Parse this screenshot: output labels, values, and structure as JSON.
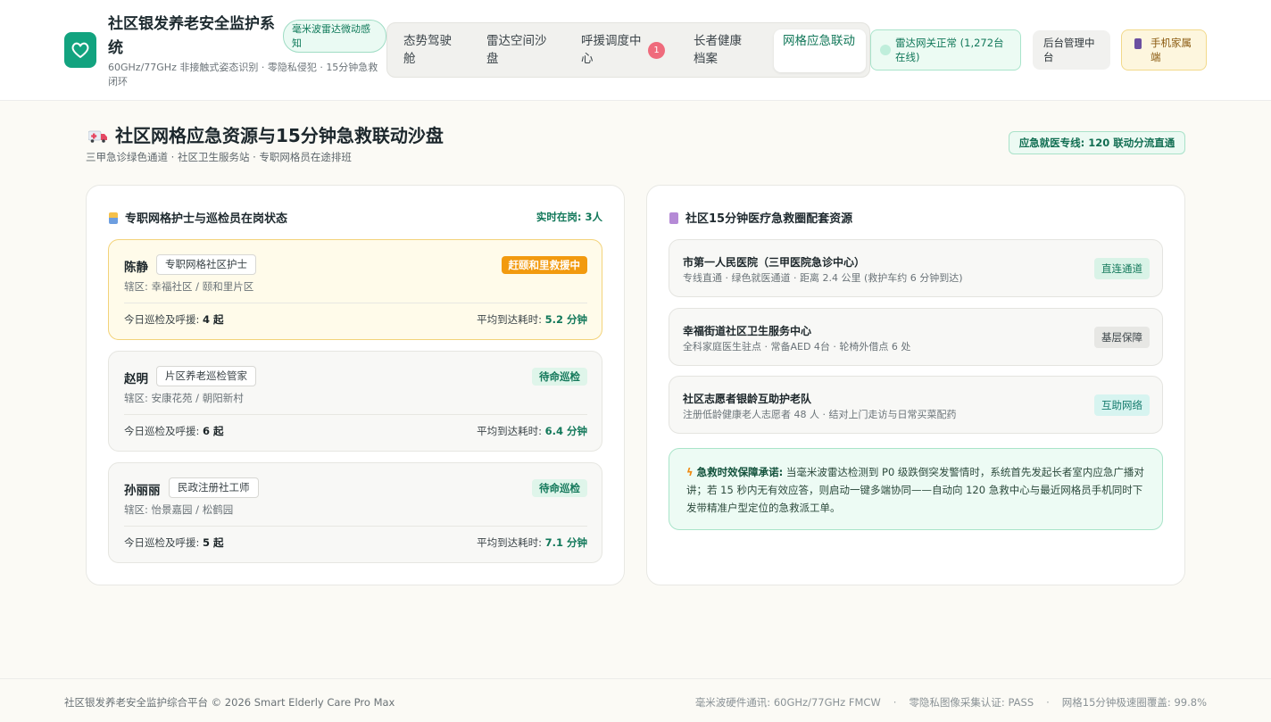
{
  "header": {
    "app_title": "社区银发养老安全监护系统",
    "app_subtitle": "60GHz/77GHz 非接触式姿态识别 · 零隐私侵犯 · 15分钟急救闭环",
    "badge": "毫米波雷达微动感知",
    "tabs": [
      {
        "label": "态势驾驶舱",
        "active": false
      },
      {
        "label": "雷达空间沙盘",
        "active": false
      },
      {
        "label": "呼援调度中心",
        "active": false,
        "count": "1"
      },
      {
        "label": "长者健康档案",
        "active": false
      },
      {
        "label": "网格应急联动",
        "active": true
      }
    ],
    "gateway_status": "雷达网关正常 (1,272台在线)",
    "admin_label": "后台管理中台",
    "family_label": "手机家属端"
  },
  "page": {
    "title": "社区网格应急资源与15分钟急救联动沙盘",
    "subtitle": "三甲急诊绿色通道 · 社区卫生服务站 · 专职网格员在途排班",
    "hotline": "应急就医专线: 120 联动分流直通"
  },
  "staff_panel": {
    "title": "专职网格护士与巡检员在岗状态",
    "on_duty": "实时在岗: 3人",
    "patrol_label": "今日巡检及呼援:",
    "eta_label": "平均到达耗时:",
    "staff": [
      {
        "name": "陈静",
        "role": "专职网格社区护士",
        "area": "辖区: 幸福社区 / 颐和里片区",
        "status": "赶颐和里救援中",
        "status_type": "rescue",
        "patrols": "4 起",
        "eta": "5.2 分钟"
      },
      {
        "name": "赵明",
        "role": "片区养老巡检管家",
        "area": "辖区: 安康花苑 / 朝阳新村",
        "status": "待命巡检",
        "status_type": "standby",
        "patrols": "6 起",
        "eta": "6.4 分钟"
      },
      {
        "name": "孙丽丽",
        "role": "民政注册社工师",
        "area": "辖区: 怡景嘉园 / 松鹤园",
        "status": "待命巡检",
        "status_type": "standby",
        "patrols": "5 起",
        "eta": "7.1 分钟"
      }
    ]
  },
  "resource_panel": {
    "title": "社区15分钟医疗急救圈配套资源",
    "resources": [
      {
        "name": "市第一人民医院（三甲医院急诊中心）",
        "desc": "专线直通 · 绿色就医通道 · 距离 2.4 公里 (救护车约 6 分钟到达)",
        "tag": "直连通道"
      },
      {
        "name": "幸福街道社区卫生服务中心",
        "desc": "全科家庭医生驻点 · 常备AED 4台 · 轮椅外借点 6 处",
        "tag": "基层保障"
      },
      {
        "name": "社区志愿者银龄互助护老队",
        "desc": "注册低龄健康老人志愿者 48 人 · 结对上门走访与日常买菜配药",
        "tag": "互助网络"
      }
    ],
    "guarantee_title": "急救时效保障承诺:",
    "guarantee_text": "当毫米波雷达检测到 P0 级跌倒突发警情时，系统首先发起长者室内应急广播对讲；若 15 秒内无有效应答，则启动一键多端协同——自动向 120 急救中心与最近网格员手机同时下发带精准户型定位的急救派工单。"
  },
  "footer": {
    "copyright": "社区银发养老安全监护综合平台 © 2026 Smart Elderly Care Pro Max",
    "specs": [
      "毫米波硬件通讯: 60GHz/77GHz FMCW",
      "零隐私图像采集认证: PASS",
      "网格15分钟极速圈覆盖: 99.8%"
    ],
    "separator": "·"
  },
  "colors": {
    "brand": "#12a37f",
    "accent_green": "#12785a",
    "rescue": "#f29a0f",
    "badge_red": "#ef6b7c"
  }
}
